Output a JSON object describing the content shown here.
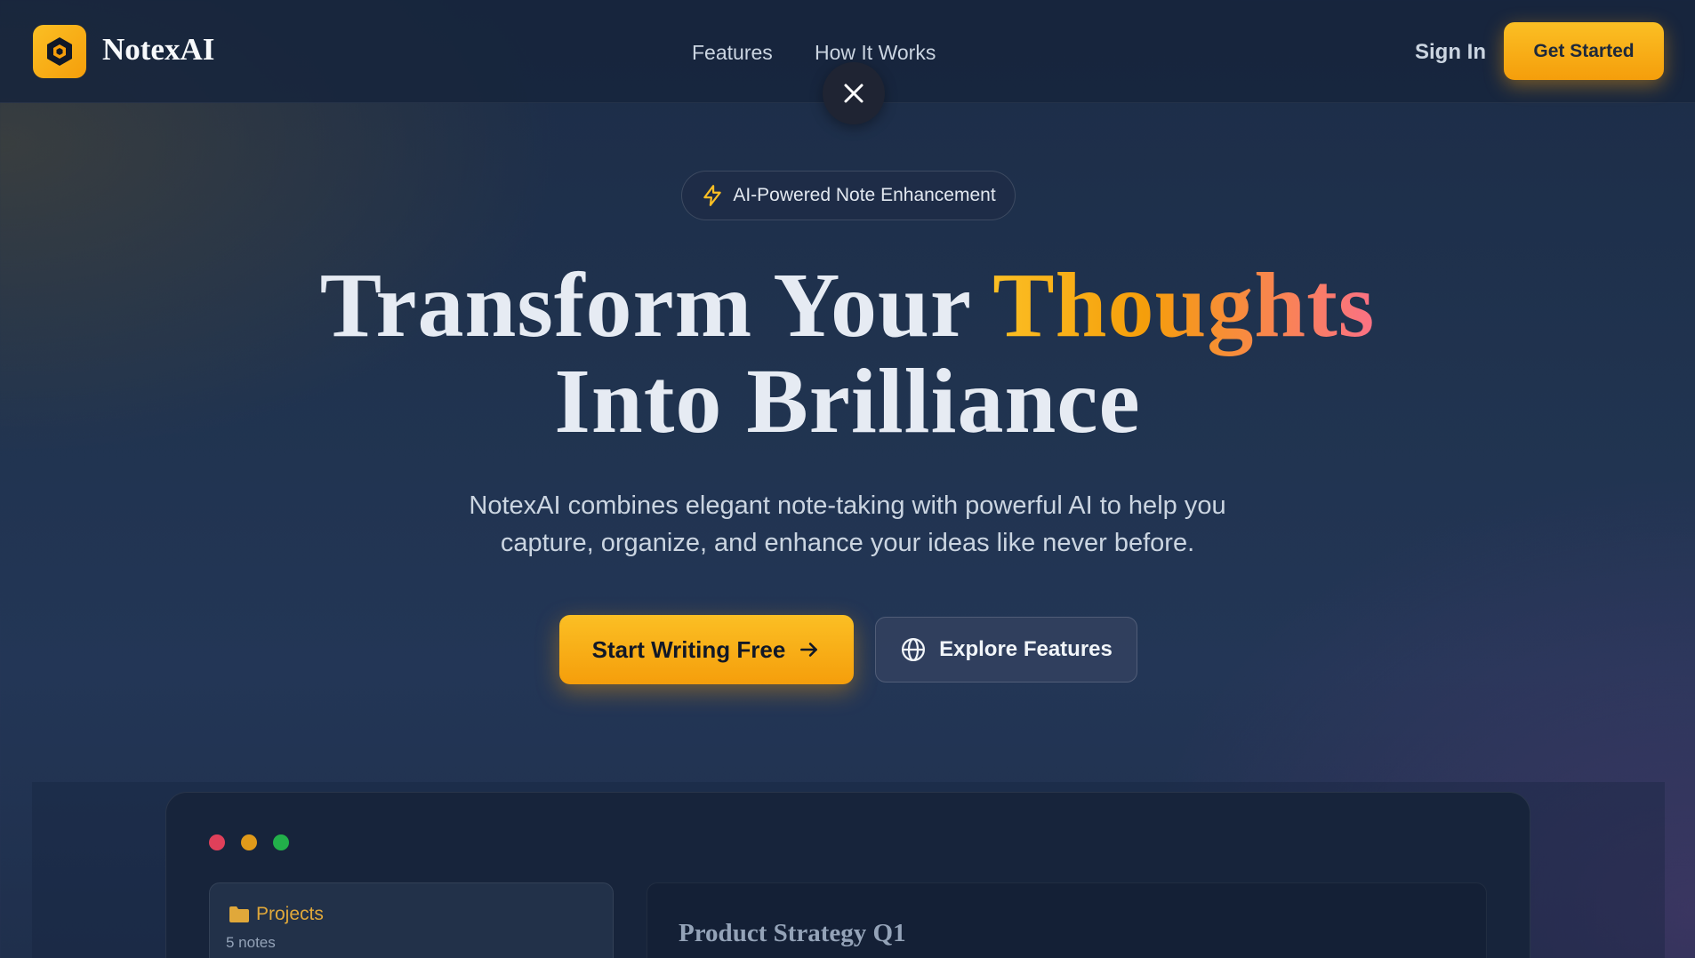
{
  "nav": {
    "brand": "NotexAI",
    "links": [
      "Features",
      "How It Works"
    ],
    "sign_in": "Sign In",
    "get_started": "Get Started"
  },
  "hero": {
    "badge": "AI-Powered Note Enhancement",
    "headline_part1": "Transform Your ",
    "headline_highlight": "Thoughts",
    "headline_line2": "Into Brilliance",
    "subtitle_line1": "NotexAI combines elegant note-taking with powerful AI to help you",
    "subtitle_line2": "capture, organize, and enhance your ideas like never before.",
    "primary_cta": "Start Writing Free",
    "secondary_cta": "Explore Features"
  },
  "preview": {
    "folder_name": "Projects",
    "folder_count": "5 notes",
    "note_title": "Product Strategy Q1"
  },
  "colors": {
    "accent": "#f59e0b",
    "accent_light": "#fbbf24",
    "highlight_end": "#fb7185",
    "window_red": "#e0405a",
    "window_amber": "#e09a1a",
    "window_green": "#22b04a"
  },
  "icons": {
    "logo": "hexagon-logo-icon",
    "close": "close-icon",
    "badge": "lightning-icon",
    "primary_cta": "arrow-right-icon",
    "secondary_cta": "globe-icon",
    "folder": "folder-icon"
  }
}
